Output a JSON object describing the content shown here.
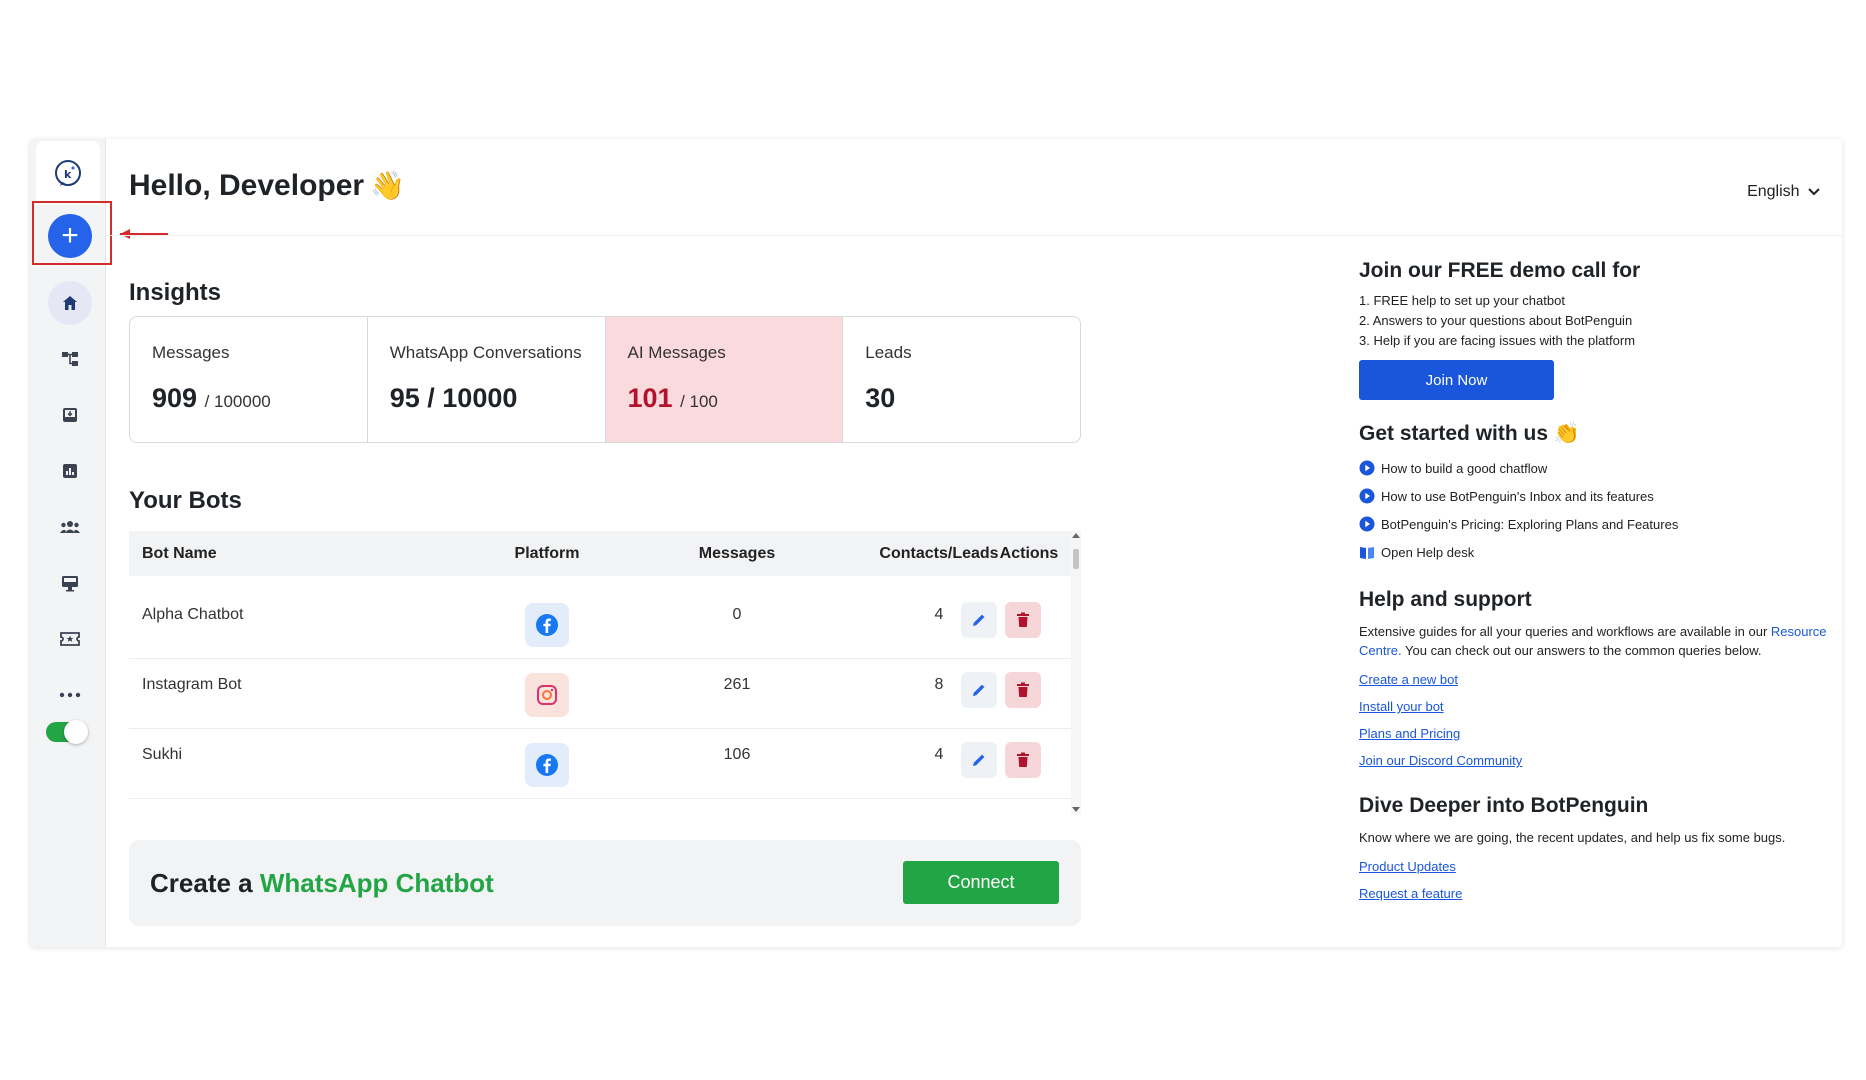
{
  "header": {
    "greeting": "Hello, Developer",
    "greeting_emoji": "👋",
    "language": "English"
  },
  "colors": {
    "primary_blue": "#2563eb",
    "whatsapp_green": "#22a545",
    "alert_bg": "#fadadd",
    "alert_text": "#b3122c",
    "annotation_red": "#d62b2b"
  },
  "sidebar": {
    "items": [
      {
        "icon": "botpenguin-logo-icon"
      },
      {
        "icon": "plus-icon"
      },
      {
        "icon": "home-icon"
      },
      {
        "icon": "flow-icon"
      },
      {
        "icon": "inbox-icon"
      },
      {
        "icon": "analytics-icon"
      },
      {
        "icon": "team-icon"
      },
      {
        "icon": "monitor-icon"
      },
      {
        "icon": "ticket-icon"
      },
      {
        "icon": "more-icon"
      }
    ],
    "toggle_on": true
  },
  "insights": {
    "title": "Insights",
    "stats": [
      {
        "label": "Messages",
        "value": "909",
        "max": "/ 100000"
      },
      {
        "label": "WhatsApp Conversations",
        "value": "95 / 10000",
        "max": ""
      },
      {
        "label": "AI Messages",
        "value": "101",
        "max": "/ 100"
      },
      {
        "label": "Leads",
        "value": "30",
        "max": ""
      }
    ]
  },
  "bots": {
    "title": "Your Bots",
    "columns": [
      "Bot Name",
      "Platform",
      "Messages",
      "Contacts/Leads",
      "Actions"
    ],
    "rows": [
      {
        "name": "Alpha Chatbot",
        "platform": "facebook",
        "messages": "0",
        "contacts": "4"
      },
      {
        "name": "Instagram Bot",
        "platform": "instagram",
        "messages": "261",
        "contacts": "8"
      },
      {
        "name": "Sukhi",
        "platform": "facebook",
        "messages": "106",
        "contacts": "4"
      }
    ]
  },
  "whatsapp_banner": {
    "prefix": "Create a ",
    "highlight": "WhatsApp Chatbot",
    "button": "Connect"
  },
  "right_panel": {
    "demo": {
      "title": "Join our FREE demo call for",
      "items": [
        "1. FREE help to set up your chatbot",
        "2. Answers to your questions about BotPenguin",
        "3. Help if you are facing issues with the platform"
      ],
      "button": "Join Now"
    },
    "get_started": {
      "title": "Get started with us",
      "emoji": "👏",
      "items": [
        {
          "icon": "play-icon",
          "text": "How to build a good chatflow"
        },
        {
          "icon": "play-icon",
          "text": "How to use BotPenguin's Inbox and its features"
        },
        {
          "icon": "play-icon",
          "text": "BotPenguin's Pricing: Exploring Plans and Features"
        },
        {
          "icon": "book-icon",
          "text": "Open Help desk"
        }
      ]
    },
    "help": {
      "title": "Help and support",
      "text_before": "Extensive guides for all your queries and workflows are available in our ",
      "text_link": "Resource Centre.",
      "text_after": " You can check out our answers to the common queries below.",
      "links": [
        "Create a new bot",
        "Install your bot",
        "Plans and Pricing",
        "Join our Discord Community"
      ]
    },
    "dive": {
      "title": "Dive Deeper into BotPenguin",
      "text": "Know where we are going, the recent updates, and help us fix some bugs.",
      "links": [
        "Product Updates",
        "Request a feature"
      ]
    }
  }
}
